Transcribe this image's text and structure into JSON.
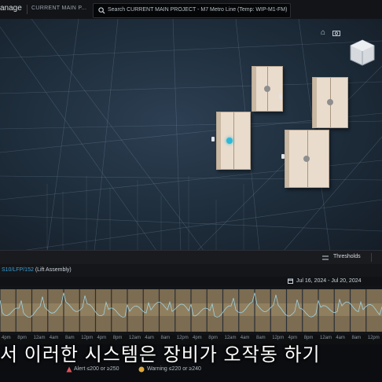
{
  "header": {
    "app_title": "anage",
    "project_label": "CURRENT MAIN P...",
    "search_text": "Search CURRENT MAIN PROJECT - M7 Metro Line (Temp: WIP-M1-FM)"
  },
  "viewport": {
    "icons": [
      "home-icon",
      "camera-icon",
      "view-cube"
    ]
  },
  "toolbar": {
    "thresholds_label": "Thresholds"
  },
  "sensor": {
    "id": "S10/LFP/152",
    "name": "(Lift Assembly)"
  },
  "chart": {
    "date_range": "Jul 16, 2024 - Jul 20, 2024"
  },
  "timeline_ticks": [
    "4pm",
    "8pm",
    "12am",
    "4am",
    "8am",
    "12pm",
    "4pm",
    "8pm",
    "12am",
    "4am",
    "8am",
    "12pm",
    "4pm",
    "8pm",
    "12am",
    "4am",
    "8am",
    "12pm",
    "4pm",
    "8pm",
    "12am",
    "4am",
    "8am",
    "12pm"
  ],
  "legend": {
    "alert": "Alert ≤200 or ≥250",
    "warning": "Warning ≤220 or ≥240"
  },
  "caption": "서 이러한 시스템은 장비가 오작동 하기",
  "colors": {
    "accent": "#2fb7d6",
    "alert": "#e0525a",
    "warning": "#e0a83a",
    "band": "#a08a66"
  }
}
